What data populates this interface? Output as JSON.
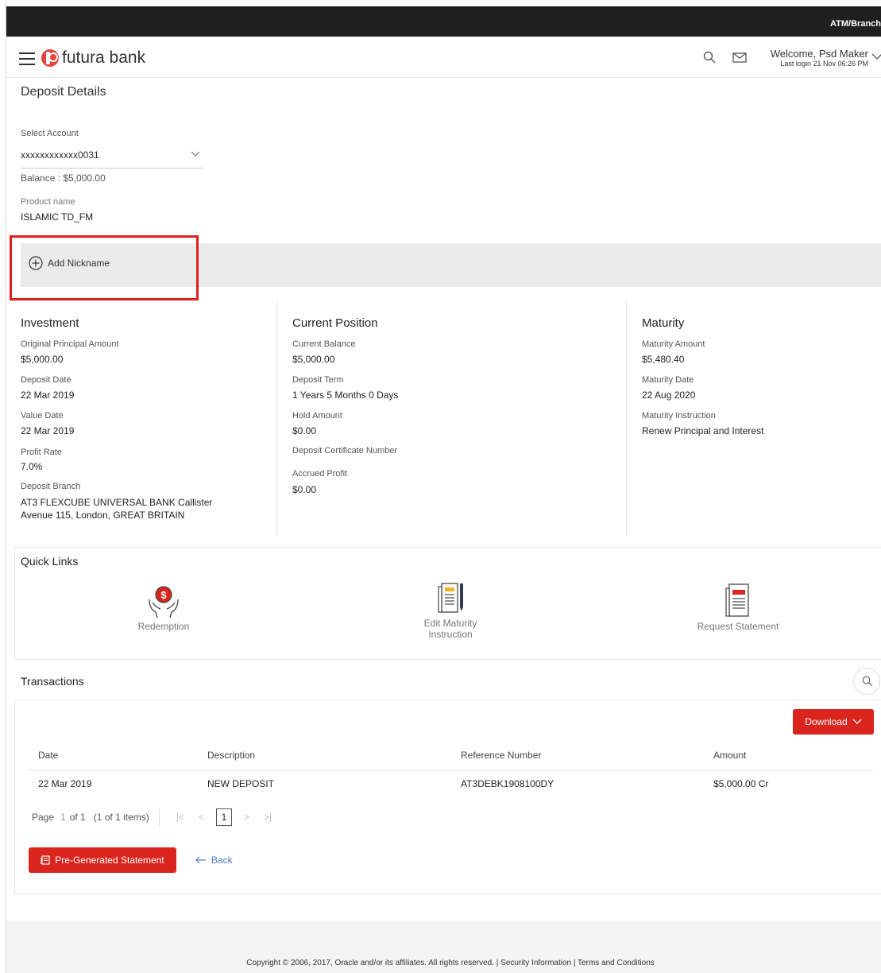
{
  "topbar": {
    "text": "ATM/Branch"
  },
  "header": {
    "brand": "futura bank",
    "welcome": "Welcome, Psd Maker",
    "last_login": "Last login 21 Nov 06:26 PM"
  },
  "page": {
    "title": "Deposit Details"
  },
  "account": {
    "select_label": "Select Account",
    "selected": "xxxxxxxxxxxx0031",
    "balance": "Balance : $5,000.00",
    "product_label": "Product name",
    "product_value": "ISLAMIC TD_FM",
    "nickname_action": "Add Nickname"
  },
  "investment": {
    "title": "Investment",
    "fields": [
      {
        "label": "Original Principal Amount",
        "value": "$5,000.00"
      },
      {
        "label": "Deposit Date",
        "value": "22 Mar 2019"
      },
      {
        "label": "Value Date",
        "value": "22 Mar 2019"
      },
      {
        "label": "Profit Rate",
        "value": "7.0%"
      },
      {
        "label": "Deposit Branch",
        "value": "AT3 FLEXCUBE UNIVERSAL BANK Callister",
        "value2": "Avenue 115, London, GREAT BRITAIN"
      }
    ]
  },
  "current_position": {
    "title": "Current Position",
    "fields": [
      {
        "label": "Current Balance",
        "value": "$5,000.00"
      },
      {
        "label": "Deposit Term",
        "value": "1 Years 5 Months 0 Days"
      },
      {
        "label": "Hold Amount",
        "value": "$0.00"
      },
      {
        "label": "Deposit Certificate Number",
        "value": ""
      },
      {
        "label": "Accrued Profit",
        "value": "$0.00"
      }
    ]
  },
  "maturity": {
    "title": "Maturity",
    "fields": [
      {
        "label": "Maturity Amount",
        "value": "$5,480.40"
      },
      {
        "label": "Maturity Date",
        "value": "22 Aug 2020"
      },
      {
        "label": "Maturity Instruction",
        "value": "Renew Principal and Interest"
      }
    ]
  },
  "quick_links": {
    "title": "Quick Links",
    "items": [
      {
        "label": "Redemption",
        "icon": "redemption-icon"
      },
      {
        "label": "Edit Maturity",
        "label2": "Instruction",
        "icon": "edit-maturity-icon"
      },
      {
        "label": "Request Statement",
        "icon": "request-statement-icon"
      }
    ]
  },
  "transactions": {
    "title": "Transactions",
    "download_label": "Download",
    "columns": [
      "Date",
      "Description",
      "Reference Number",
      "Amount"
    ],
    "rows": [
      [
        "22 Mar 2019",
        "NEW DEPOSIT",
        "AT3DEBK1908100DY",
        "$5,000.00 Cr"
      ]
    ],
    "pager": {
      "page_word": "Page",
      "page_num": "1",
      "of_pages": "of 1",
      "items_info": "(1 of 1 items)",
      "current": "1"
    }
  },
  "actions": {
    "pregenerated": "Pre-Generated Statement",
    "back": "Back"
  },
  "footer": {
    "text": "Copyright © 2006, 2017, Oracle and/or its affiliates. All rights reserved. | Security Information | Terms and Conditions"
  },
  "colors": {
    "brand_red": "#d9251d",
    "topbar": "#1f1f1f",
    "highlight": "#e0201d"
  }
}
